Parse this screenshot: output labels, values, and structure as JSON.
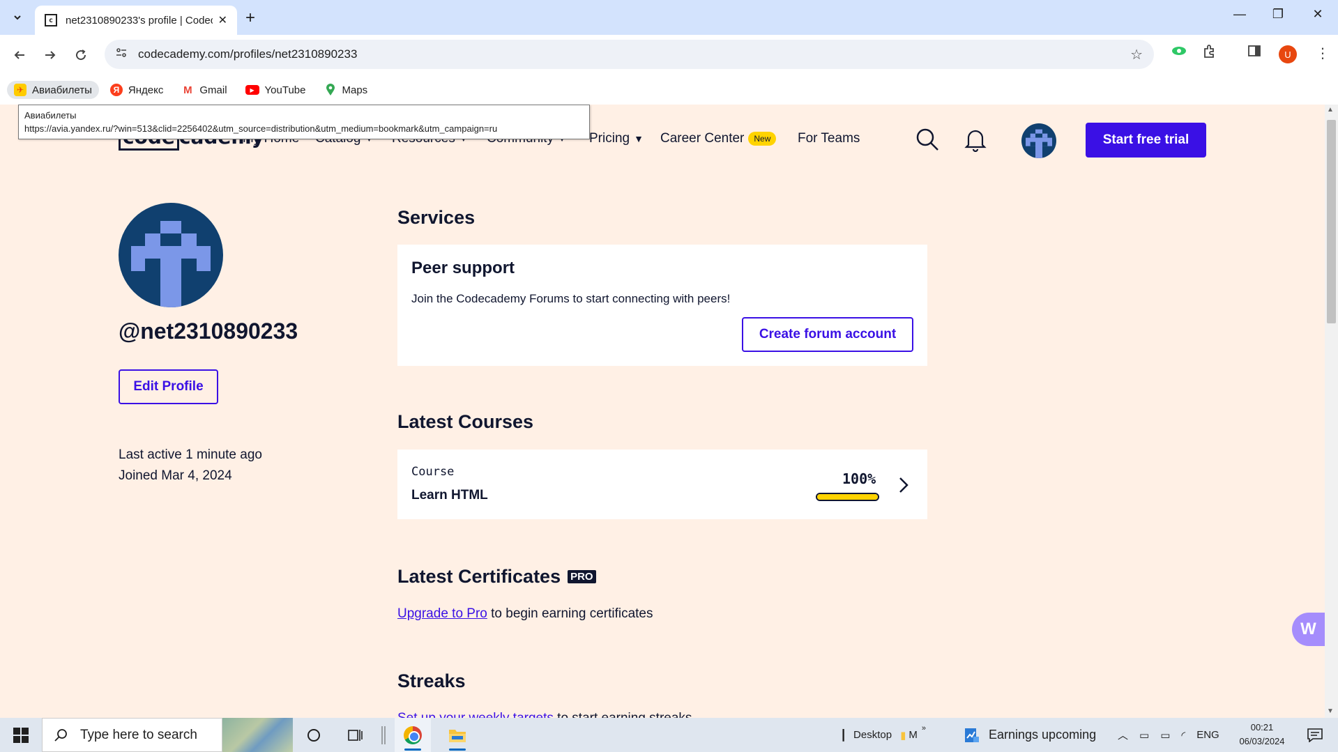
{
  "browser": {
    "tab_title": "net2310890233's profile | Codecademy",
    "url": "codecademy.com/profiles/net2310890233",
    "profile_initial": "U",
    "bookmarks": [
      {
        "label": "Авиабилеты",
        "icon": "avia-icon",
        "color": "#ffcc00"
      },
      {
        "label": "Яндекс",
        "icon": "yandex-icon",
        "color": "#fc3f1d"
      },
      {
        "label": "Gmail",
        "icon": "gmail-icon",
        "color": "#ea4335"
      },
      {
        "label": "YouTube",
        "icon": "youtube-icon",
        "color": "#ff0000"
      },
      {
        "label": "Maps",
        "icon": "maps-icon",
        "color": "#34a853"
      }
    ],
    "tooltip": {
      "title": "Авиабилеты",
      "url": "https://avia.yandex.ru/?win=513&clid=2256402&utm_source=distribution&utm_medium=bookmark&utm_campaign=ru"
    }
  },
  "site_nav": {
    "logo_code": "code",
    "logo_rest": "cademy",
    "items": {
      "my_home": "My Home",
      "catalog": "Catalog",
      "resources": "Resources",
      "community": "Community",
      "pricing": "Pricing",
      "career_center": "Career Center",
      "career_badge": "New",
      "for_teams": "For Teams"
    },
    "cta": "Start free trial"
  },
  "profile": {
    "username": "@net2310890233",
    "edit_label": "Edit Profile",
    "last_active": "Last active 1 minute ago",
    "joined": "Joined Mar 4, 2024"
  },
  "services": {
    "title": "Services",
    "card_title": "Peer support",
    "card_desc": "Join the Codecademy Forums to start connecting with peers!",
    "button": "Create forum account"
  },
  "courses": {
    "title": "Latest Courses",
    "items": [
      {
        "kind": "Course",
        "name": "Learn HTML",
        "progress_label": "100%",
        "progress": 1.0
      }
    ]
  },
  "certificates": {
    "title": "Latest Certificates",
    "badge": "PRO",
    "link": "Upgrade to Pro",
    "text": " to begin earning certificates"
  },
  "streaks": {
    "title": "Streaks",
    "link": "Set up your weekly targets",
    "text": " to start earning streaks"
  },
  "widget_letter": "W",
  "taskbar": {
    "search_placeholder": "Type here to search",
    "desktop_label": "Desktop",
    "desktop_more": "M",
    "news": "Earnings upcoming",
    "lang": "ENG",
    "time": "00:21",
    "date": "06/03/2024"
  },
  "colors": {
    "accent": "#3a10e5",
    "page_bg": "#fff0e5",
    "navy": "#10162f",
    "progress": "#ffd300"
  }
}
